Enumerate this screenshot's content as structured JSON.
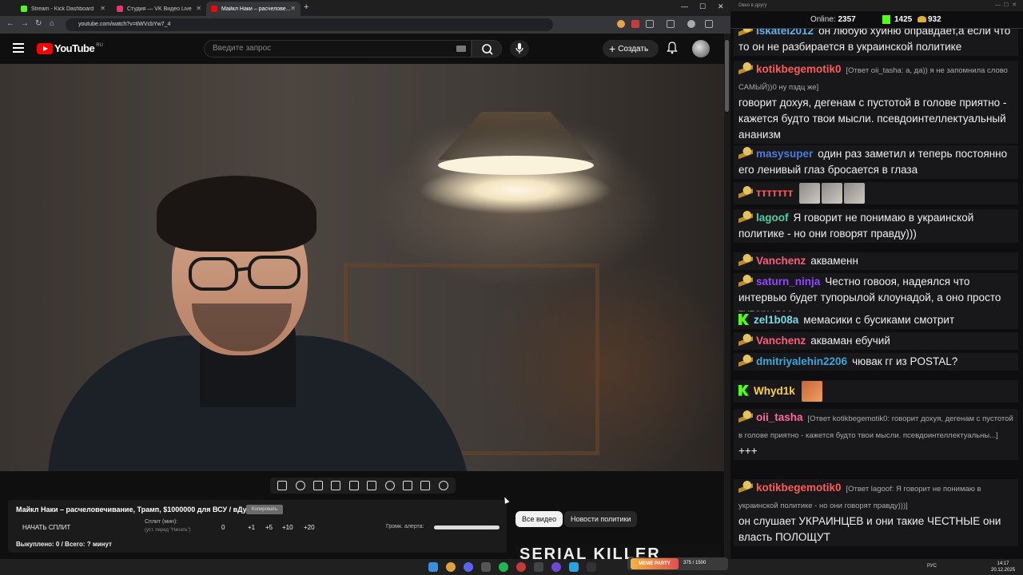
{
  "browser": {
    "tabs": [
      {
        "label": "Stream - Kick Dashboard",
        "color": "#53fc18"
      },
      {
        "label": "Студия — VK Видео Live",
        "color": "#e7356b"
      },
      {
        "label": "Майкл Наки – расчелове...",
        "color": "#ff0000"
      }
    ],
    "new_tab": "+",
    "url": "youtube.com/watch?v=tiWVcbYw7_4"
  },
  "youtube": {
    "logo": "YouTube",
    "region": "RU",
    "search_placeholder": "Введите запрос",
    "create_label": "Создать"
  },
  "ext": {
    "title": "Майкл Наки – расчеловечивание, Трамп, $1000000 для ВСУ / вДудь",
    "copy_label": "Копировать",
    "start_split": "НАЧАТЬ СПЛИТ",
    "split_label": "Сплит (мин):",
    "split_hint": "(уст. перед \"Начать\")",
    "split_value": "0",
    "increments": [
      "+1",
      "+5",
      "+10",
      "+20"
    ],
    "alert_volume": "Громк. алерта:",
    "alert_volume_level": 1.0,
    "bought": "Выкуплено: 0 / Всего: ? минут"
  },
  "chips": [
    "Все видео",
    "Новости политики"
  ],
  "thumbnail_text": "SERIAL KILLER",
  "chat": {
    "window_title": "Окно в другу",
    "online_label": "Online:",
    "online": "2357",
    "kick_count": "1425",
    "vk_count": "932",
    "messages": [
      {
        "badge": "vk",
        "nick": "iskatel2012",
        "color": "#62b0e8",
        "text": "он любую хуйню оправдает,а если что то он не разбирается в украинской политике"
      },
      {
        "badge": "vk",
        "nick": "kotikbegemotik0",
        "color": "#ff5a5a",
        "reply": "[Ответ oii_tasha: а, да)) я не запомнила слово САМЫЙ))0 ну пздц же]",
        "text": "говорит дохуя, дегенам с пустотой в голове приятно - кажется будто твои мысли. псевдоинтеллектуальный ананизм"
      },
      {
        "badge": "vk",
        "nick": "masysuper",
        "color": "#4a7bd8",
        "text": "один раз заметил и теперь постоянно его ленивый глаз бросается в глаза"
      },
      {
        "badge": "vk",
        "nick": "ттттттт",
        "color": "#ff5a5a",
        "emotes": 3
      },
      {
        "badge": "vk",
        "nick": "lagoof",
        "color": "#4fcfa0",
        "text": "Я говорит не понимаю в украинской политике - но они говорят правду)))"
      },
      {
        "badge": "vk",
        "nick": "Vanchenz",
        "color": "#ff5a7e",
        "text": "акваменн"
      },
      {
        "badge": "vk",
        "nick": "saturn_ninja",
        "color": "#9147ff",
        "text": "Честно говооя, надеялся что интервью будет тупорылой клоунадой, а оно просто тупорылое"
      },
      {
        "badge": "kick",
        "nick": "zel1b08a",
        "color": "#7ad9e8",
        "text": "мемасики с бусиками смотрит"
      },
      {
        "badge": "vk",
        "nick": "Vanchenz",
        "color": "#ff5a7e",
        "text": "акваман ебучий"
      },
      {
        "badge": "vk",
        "nick": "dmitriyalehin2206",
        "color": "#3aa6d8",
        "text": "чювак гг из POSTAL?"
      },
      {
        "badge": "kick",
        "nick": "Whyd1k",
        "color": "#ffd23a",
        "emotes": 1
      },
      {
        "badge": "vk",
        "nick": "oii_tasha",
        "color": "#ff6a9a",
        "reply": "[Ответ kotikbegemotik0: говорит дохуя, дегенам с пустотой в голове приятно - кажется будто твои мысли. псевдоинтеллектуальны...]",
        "text": "+++"
      },
      {
        "badge": "vk",
        "nick": "kotikbegemotik0",
        "color": "#ff5a5a",
        "reply": "[Ответ lagoof: Я говорит не понимаю в украинской политике - но они говорят правду)))]",
        "text": "он слушает УКРАИНЦЕВ и они такие ЧЕСТНЫЕ они власть ПОЛОЩУТ"
      }
    ]
  },
  "meme_party": {
    "title": "MEME PARTY",
    "progress": "375 / 1500"
  },
  "taskbar": {
    "lang": "РУС",
    "time": "14:17",
    "date": "20.12.2025"
  }
}
